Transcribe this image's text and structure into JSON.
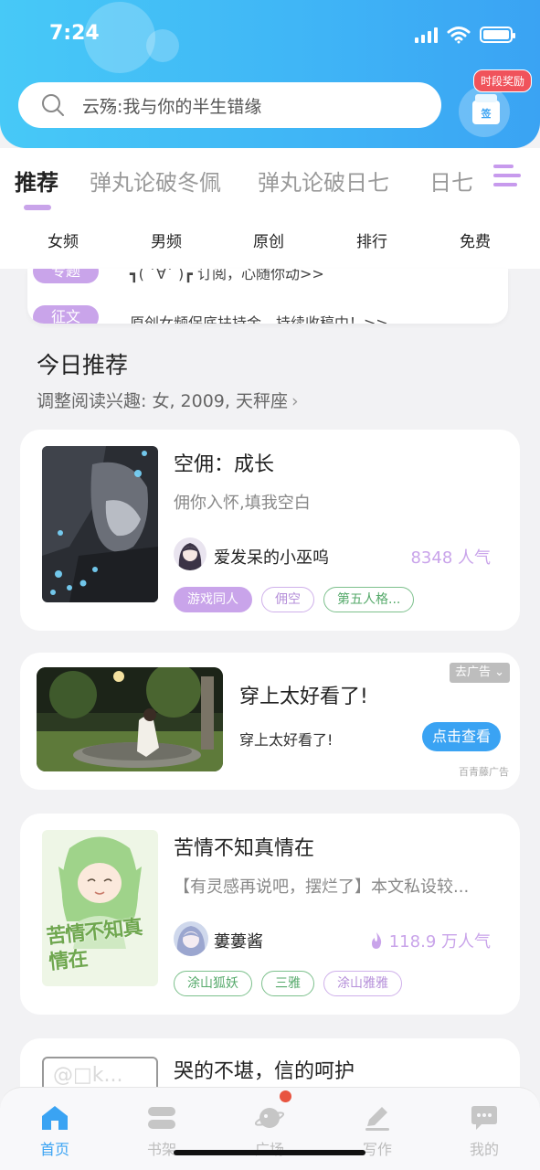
{
  "status_bar": {
    "time": "7:24"
  },
  "search": {
    "placeholder_text": "云殇:我与你的半生错缘"
  },
  "reward": {
    "badge": "时段奖励",
    "sign_label": "签"
  },
  "tabs": [
    {
      "label": "推荐"
    },
    {
      "label": "弹丸论破冬佩"
    },
    {
      "label": "弹丸论破日七"
    },
    {
      "label": "日七"
    }
  ],
  "subtabs": [
    {
      "label": "女频"
    },
    {
      "label": "男频"
    },
    {
      "label": "原创"
    },
    {
      "label": "排行"
    },
    {
      "label": "免费"
    }
  ],
  "notices": [
    {
      "tag": "专题",
      "text": "┓( ´∀` )┏ 订阅，心随你动>>"
    },
    {
      "tag": "征文",
      "text": "原创女频保底扶持金，持续收稿中！>>"
    }
  ],
  "section": {
    "title": "今日推荐",
    "subtitle": "调整阅读兴趣: 女, 2009, 天秤座",
    "chevron": "›"
  },
  "books": [
    {
      "title": "空佣：成长",
      "desc": "佣你入怀,填我空白",
      "author": "爱发呆的小巫呜",
      "popularity": "8348 人气",
      "tags": [
        "游戏同人",
        "佣空",
        "第五人格..."
      ]
    },
    {
      "title": "苦情不知真情在",
      "desc": "【有灵感再说吧，摆烂了】本文私设较...",
      "author": "蔞蔞酱",
      "popularity": "118.9 万人气",
      "tags": [
        "涂山狐妖",
        "三雅",
        "涂山雅雅"
      ],
      "cover_text": "苦情不知真情在"
    },
    {
      "title": "哭的不堪，信的呵护"
    }
  ],
  "ad": {
    "title": "穿上太好看了!",
    "subtitle": "穿上太好看了!",
    "button": "点击查看",
    "close": "去广告",
    "source": "百青藤广告"
  },
  "bottom_nav": [
    {
      "label": "首页",
      "icon": "home-icon"
    },
    {
      "label": "书架",
      "icon": "bookshelf-icon"
    },
    {
      "label": "广场",
      "icon": "planet-icon"
    },
    {
      "label": "写作",
      "icon": "pen-icon"
    },
    {
      "label": "我的",
      "icon": "chat-icon"
    }
  ],
  "colors": {
    "accent_blue": "#3aa3f3",
    "accent_purple": "#c9a4ea",
    "tag_green": "#55a96a"
  }
}
